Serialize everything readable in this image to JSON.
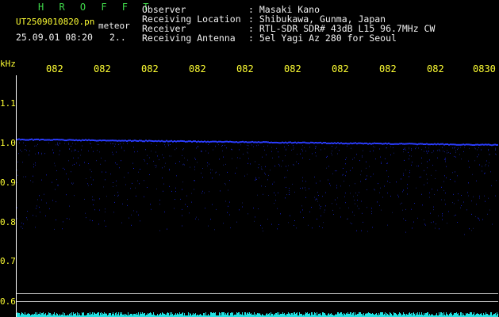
{
  "header": {
    "app_name": "H R O F F T",
    "filename": "UT2509010820.pn",
    "meteor_label": "meteor",
    "datetime": "25.09.01 08:20",
    "count": "2..",
    "fields": [
      {
        "label": "Observer",
        "value": ": Masaki Kano"
      },
      {
        "label": "Receiving Location",
        "value": ": Shibukawa, Gunma, Japan"
      },
      {
        "label": "Receiver",
        "value": ": RTL-SDR SDR# 43dB L15 96.7MHz CW"
      },
      {
        "label": "Receiving Antenna",
        "value": ": 5el Yagi Az 280 for Seoul"
      }
    ]
  },
  "axis": {
    "unit": "kHz",
    "time_ticks": [
      "082",
      "082",
      "082",
      "082",
      "082",
      "082",
      "082",
      "082",
      "082",
      "0830"
    ],
    "freq_ticks": [
      "1.1",
      "1.0",
      "0.9",
      "0.8",
      "0.7",
      "0.6"
    ]
  },
  "colors": {
    "background": "#000000",
    "title_green": "#3fd84a",
    "label_yellow": "#ffff33",
    "signal_blue": "#2a3cff",
    "noise_cyan": "#22e0e0"
  }
}
